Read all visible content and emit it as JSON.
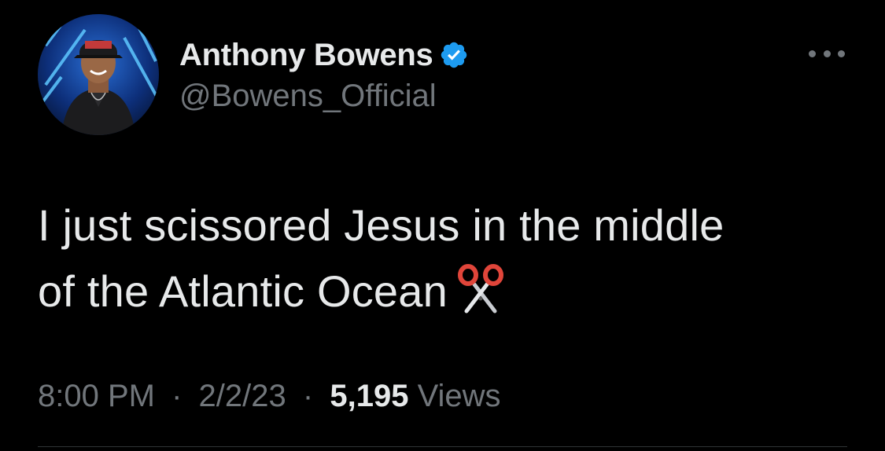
{
  "author": {
    "display_name": "Anthony Bowens",
    "handle": "@Bowens_Official",
    "verified": true,
    "verified_color": "#1d9bf0"
  },
  "tweet": {
    "line1": "I just scissored Jesus in the middle",
    "line2": "of the Atlantic Ocean",
    "emoji": "scissors-icon"
  },
  "meta": {
    "time": "8:00 PM",
    "date": "2/2/23",
    "separator": "·",
    "views_count": "5,195",
    "views_label": "Views"
  },
  "icons": {
    "more": "more-options-icon",
    "verified": "verified-badge-icon"
  },
  "theme": {
    "background": "#000000",
    "primary_text": "#e7e9ea",
    "secondary_text": "#71767b"
  }
}
